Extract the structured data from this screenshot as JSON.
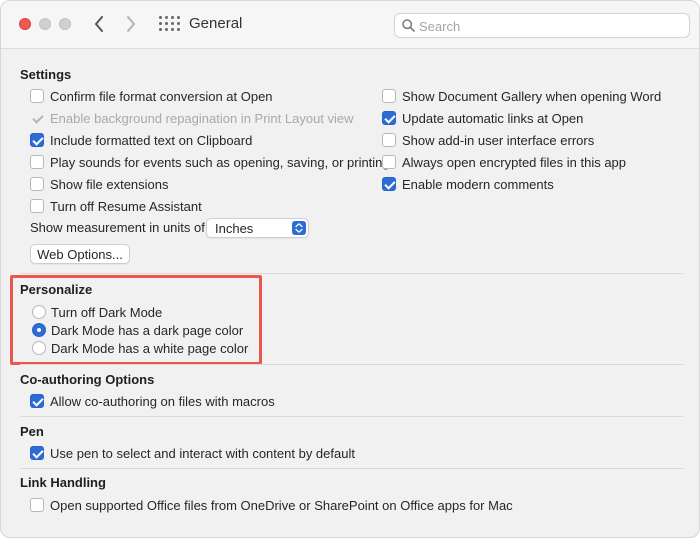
{
  "titlebar": {
    "title": "General",
    "search_placeholder": "Search"
  },
  "settings": {
    "title": "Settings",
    "left": [
      {
        "label": "Confirm file format conversion at Open",
        "checked": false,
        "disabled": false
      },
      {
        "label": "Enable background repagination in Print Layout view",
        "checked": true,
        "disabled": true
      },
      {
        "label": "Include formatted text on Clipboard",
        "checked": true,
        "disabled": false
      },
      {
        "label": "Play sounds for events such as opening, saving, or printing",
        "checked": false,
        "disabled": false
      },
      {
        "label": "Show file extensions",
        "checked": false,
        "disabled": false
      },
      {
        "label": "Turn off Resume Assistant",
        "checked": false,
        "disabled": false
      }
    ],
    "right": [
      {
        "label": "Show Document Gallery when opening Word",
        "checked": false
      },
      {
        "label": "Update automatic links at Open",
        "checked": true
      },
      {
        "label": "Show add-in user interface errors",
        "checked": false
      },
      {
        "label": "Always open encrypted files in this app",
        "checked": false
      },
      {
        "label": "Enable modern comments",
        "checked": true
      }
    ],
    "measurement_label": "Show measurement in units of:",
    "measurement_value": "Inches",
    "web_options_label": "Web Options..."
  },
  "personalize": {
    "title": "Personalize",
    "options": [
      {
        "label": "Turn off Dark Mode",
        "selected": false
      },
      {
        "label": "Dark Mode has a dark page color",
        "selected": true
      },
      {
        "label": "Dark Mode has a white page color",
        "selected": false
      }
    ]
  },
  "coauthoring": {
    "title": "Co-authoring Options",
    "option": {
      "label": "Allow co-authoring on files with macros",
      "checked": true
    }
  },
  "pen": {
    "title": "Pen",
    "option": {
      "label": "Use pen to select and interact with content by default",
      "checked": true
    }
  },
  "link_handling": {
    "title": "Link Handling",
    "option": {
      "label": "Open supported Office files from OneDrive or SharePoint on Office apps for Mac",
      "checked": false
    }
  },
  "colors": {
    "accent": "#2d6bd6",
    "highlight": "#e8584f"
  }
}
